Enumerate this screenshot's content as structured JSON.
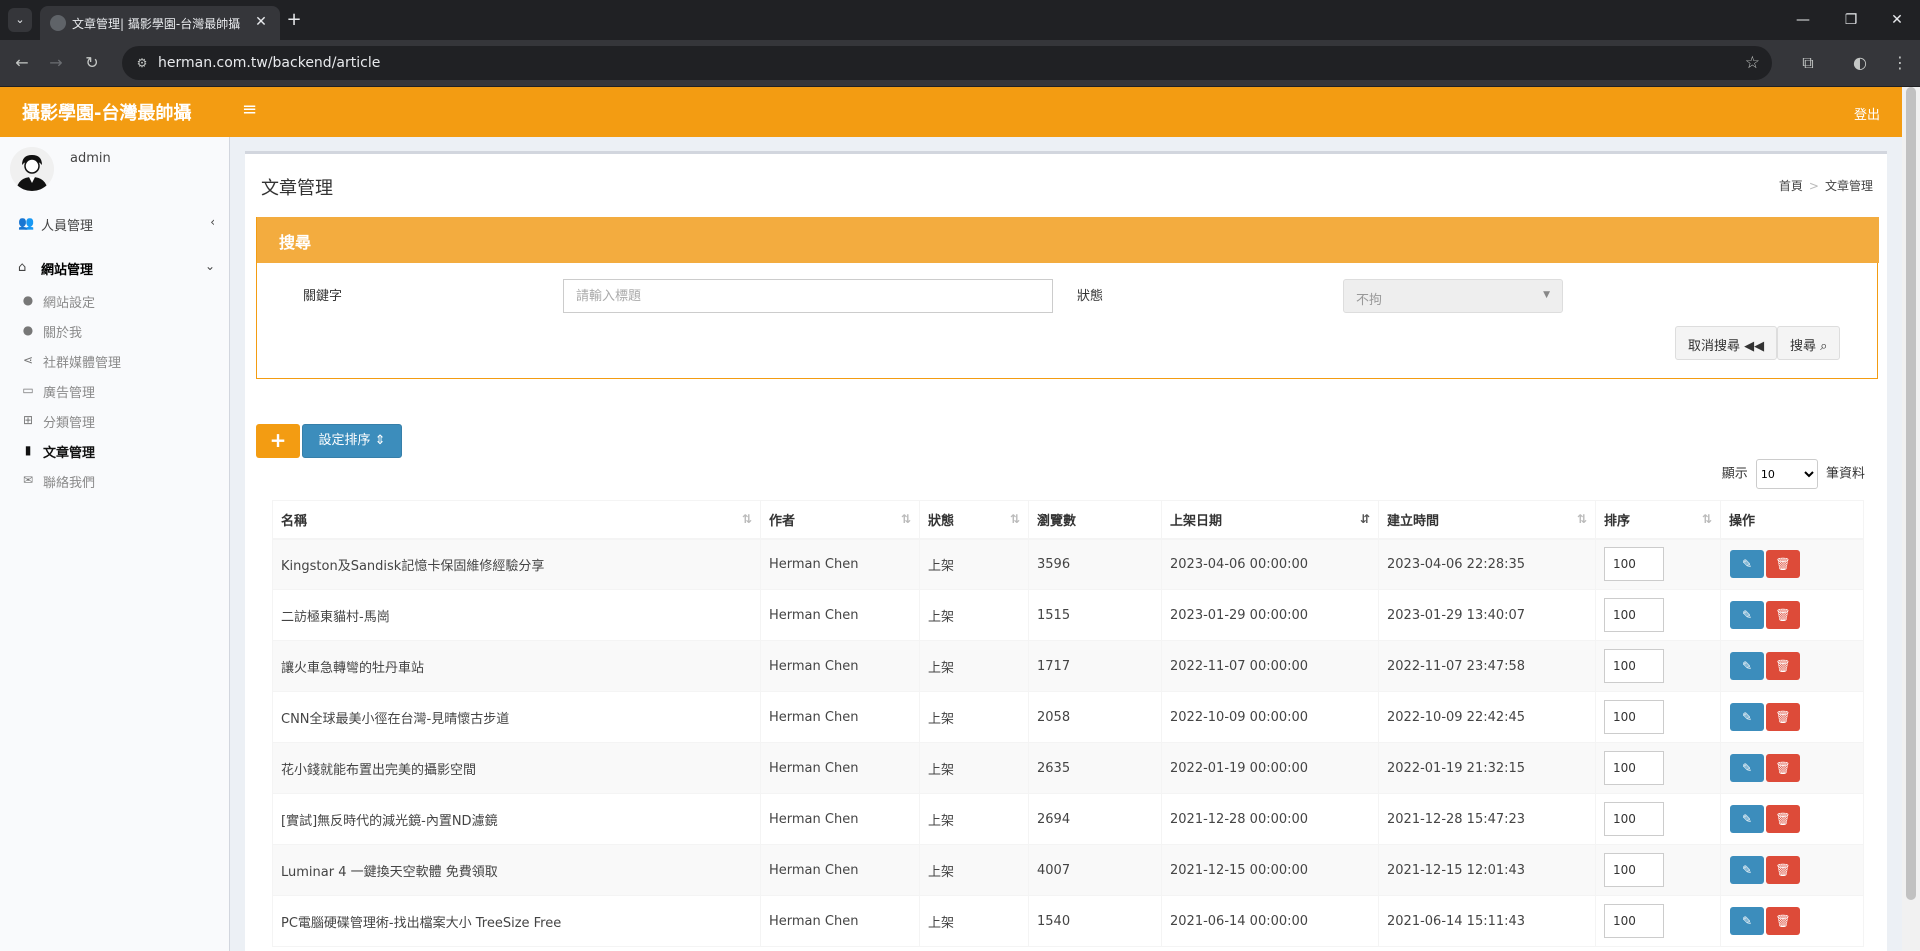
{
  "browser": {
    "tab_title": "文章管理| 攝影學園-台灣最帥攝",
    "url": "herman.com.tw/backend/article"
  },
  "header": {
    "logo": "攝影學園-台灣最帥攝",
    "logout": "登出"
  },
  "sidebar": {
    "user": "admin",
    "groups": [
      {
        "label": "人員管理",
        "icon": "users-icon"
      },
      {
        "label": "網站管理",
        "icon": "home-icon"
      }
    ],
    "items": [
      {
        "label": "網站設定",
        "icon": "user-icon"
      },
      {
        "label": "關於我",
        "icon": "user-icon"
      },
      {
        "label": "社群媒體管理",
        "icon": "share-icon"
      },
      {
        "label": "廣告管理",
        "icon": "money-icon"
      },
      {
        "label": "分類管理",
        "icon": "sitemap-icon"
      },
      {
        "label": "文章管理",
        "icon": "file-icon"
      },
      {
        "label": "聯絡我們",
        "icon": "envelope-icon"
      }
    ]
  },
  "page": {
    "title": "文章管理",
    "breadcrumb_home": "首頁",
    "breadcrumb_current": "文章管理"
  },
  "search": {
    "title": "搜尋",
    "keyword_label": "關鍵字",
    "keyword_placeholder": "請輸入標題",
    "status_label": "狀態",
    "status_value": "不拘",
    "cancel_label": "取消搜尋",
    "search_label": "搜尋"
  },
  "actions": {
    "add": "+",
    "sort_label": "設定排序"
  },
  "table": {
    "length_prefix": "顯示",
    "length_value": "10",
    "length_suffix": "筆資料",
    "headers": [
      "名稱",
      "作者",
      "狀態",
      "瀏覽數",
      "上架日期",
      "建立時間",
      "排序",
      "操作"
    ],
    "rows": [
      {
        "name": "Kingston及Sandisk記憶卡保固維修經驗分享",
        "author": "Herman Chen",
        "status": "上架",
        "views": "3596",
        "published": "2023-04-06 00:00:00",
        "created": "2023-04-06 22:28:35",
        "order": "100"
      },
      {
        "name": "二訪極東貓村-馬崗",
        "author": "Herman Chen",
        "status": "上架",
        "views": "1515",
        "published": "2023-01-29 00:00:00",
        "created": "2023-01-29 13:40:07",
        "order": "100"
      },
      {
        "name": "讓火車急轉彎的牡丹車站",
        "author": "Herman Chen",
        "status": "上架",
        "views": "1717",
        "published": "2022-11-07 00:00:00",
        "created": "2022-11-07 23:47:58",
        "order": "100"
      },
      {
        "name": "CNN全球最美小徑在台灣-見晴懷古步道",
        "author": "Herman Chen",
        "status": "上架",
        "views": "2058",
        "published": "2022-10-09 00:00:00",
        "created": "2022-10-09 22:42:45",
        "order": "100"
      },
      {
        "name": "花小錢就能布置出完美的攝影空間",
        "author": "Herman Chen",
        "status": "上架",
        "views": "2635",
        "published": "2022-01-19 00:00:00",
        "created": "2022-01-19 21:32:15",
        "order": "100"
      },
      {
        "name": "[實試]無反時代的減光鏡-內置ND濾鏡",
        "author": "Herman Chen",
        "status": "上架",
        "views": "2694",
        "published": "2021-12-28 00:00:00",
        "created": "2021-12-28 15:47:23",
        "order": "100"
      },
      {
        "name": "Luminar 4 一鍵換天空軟體 免費領取",
        "author": "Herman Chen",
        "status": "上架",
        "views": "4007",
        "published": "2021-12-15 00:00:00",
        "created": "2021-12-15 12:01:43",
        "order": "100"
      },
      {
        "name": "PC電腦硬碟管理術-找出檔案大小 TreeSize Free",
        "author": "Herman Chen",
        "status": "上架",
        "views": "1540",
        "published": "2021-06-14 00:00:00",
        "created": "2021-06-14 15:11:43",
        "order": "100"
      }
    ]
  }
}
